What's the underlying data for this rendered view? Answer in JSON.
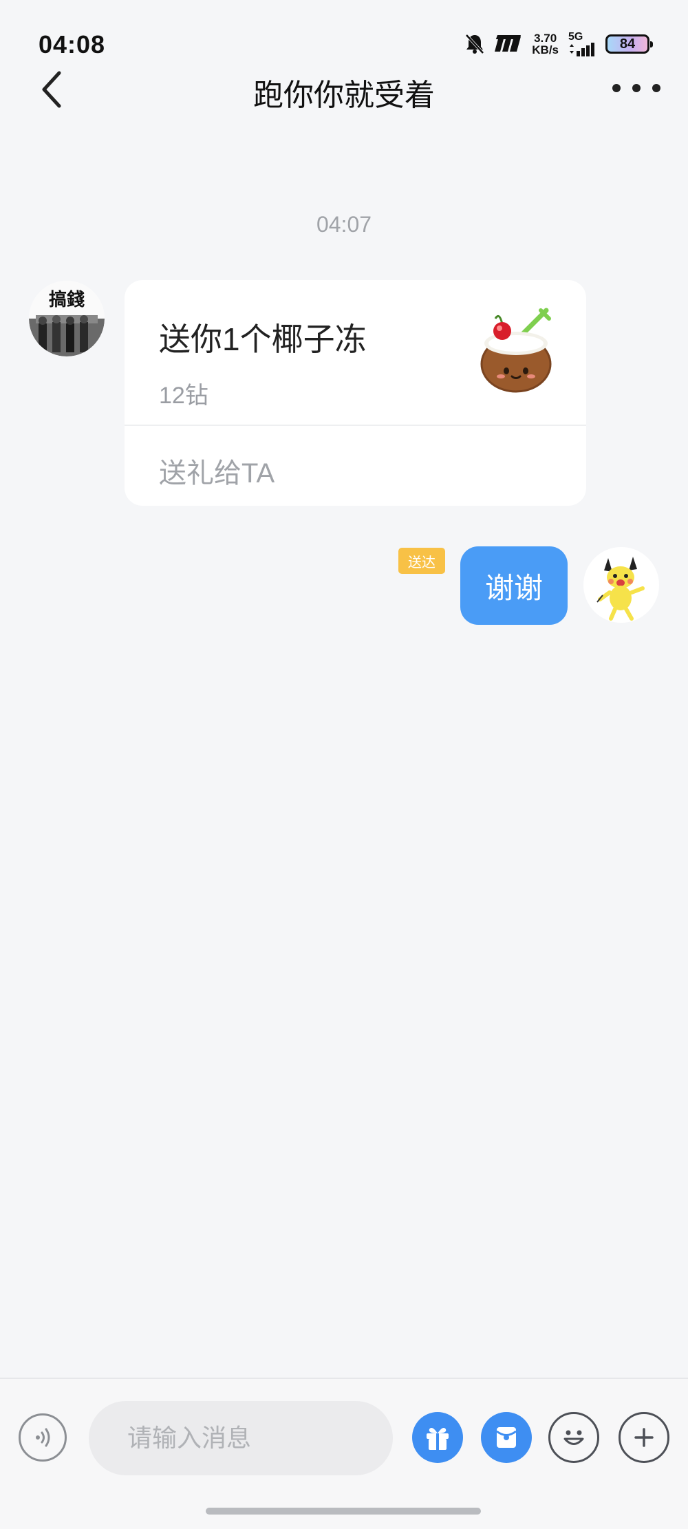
{
  "status_bar": {
    "time": "04:08",
    "net_speed_value": "3.70",
    "net_speed_unit": "KB/s",
    "network_type": "5G",
    "battery_level": "84",
    "icons": [
      "bell-muted-icon",
      "hd-icon",
      "signal-icon",
      "battery-icon"
    ]
  },
  "nav": {
    "title": "跑你你就受着",
    "back_icon": "chevron-left-icon",
    "more_icon": "more-dots-icon"
  },
  "chat": {
    "timestamp": "04:07",
    "messages": [
      {
        "side": "left",
        "type": "gift",
        "avatar_text": "搞錢",
        "gift_title": "送你1个椰子冻",
        "gift_price": "12钻",
        "gift_action": "送礼给TA",
        "gift_icon": "coconut-jelly-icon"
      },
      {
        "side": "right",
        "type": "text",
        "text": "谢谢",
        "status": "送达",
        "avatar_icon": "yellow-mascot-icon"
      }
    ]
  },
  "input_bar": {
    "placeholder": "请输入消息",
    "buttons": [
      "voice-icon",
      "gift-icon",
      "red-packet-icon",
      "emoji-icon",
      "plus-icon"
    ]
  },
  "colors": {
    "background": "#f5f6f8",
    "accent_blue": "#4a9cf6",
    "badge_yellow": "#f8c146",
    "muted_text": "#a0a3a8"
  }
}
